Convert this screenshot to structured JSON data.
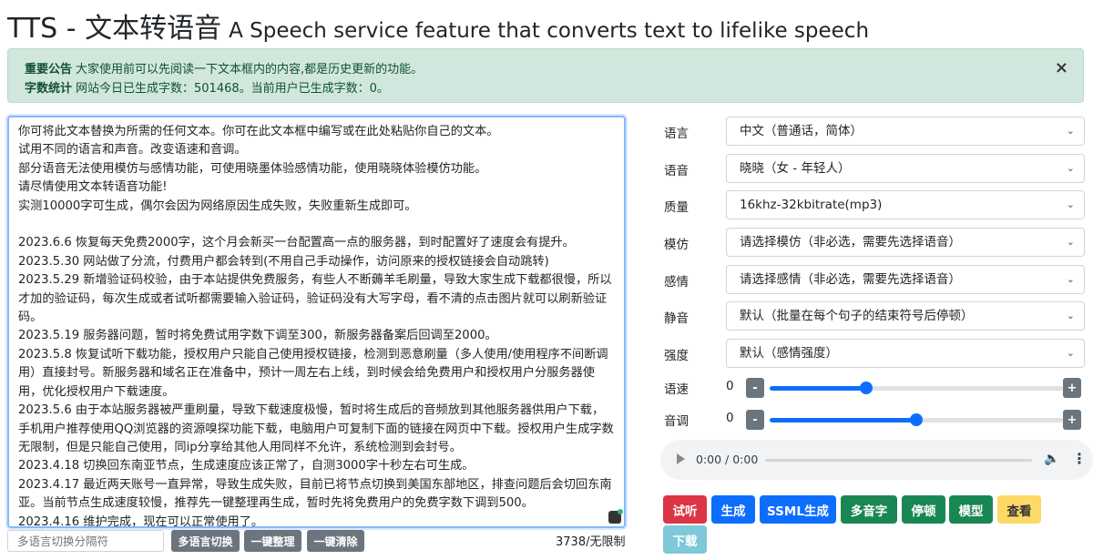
{
  "header": {
    "title_main": "TTS - 文本转语音",
    "title_sub": "A Speech service feature that converts text to lifelike speech"
  },
  "alert": {
    "notice_label": "重要公告",
    "notice_text": "大家使用前可以先阅读一下文本框内的内容,都是历史更新的功能。",
    "stats_label": "字数统计",
    "stats_text": "网站今日已生成字数：501468。当前用户已生成字数：0。",
    "close": "×"
  },
  "editor": {
    "text": "你可将此文本替换为所需的任何文本。你可在此文本框中编写或在此处粘贴你自己的文本。\n试用不同的语言和声音。改变语速和音调。\n部分语音无法使用模仿与感情功能，可使用晓墨体验感情功能，使用晓晓体验模仿功能。\n请尽情使用文本转语音功能!\n实测10000字可生成，偶尔会因为网络原因生成失败，失败重新生成即可。\n\n2023.6.6 恢复每天免费2000字，这个月会新买一台配置高一点的服务器，到时配置好了速度会有提升。\n2023.5.30 网站做了分流，付费用户都会转到(不用自己手动操作，访问原来的授权链接会自动跳转)\n2023.5.29 新增验证码校验，由于本站提供免费服务，有些人不断薅羊毛刷量，导致大家生成下载都很慢，所以才加的验证码，每次生成或者试听都需要输入验证码，验证码没有大写字母，看不清的点击图片就可以刷新验证码。\n2023.5.19 服务器问题，暂时将免费试用字数下调至300，新服务器备案后回调至2000。\n2023.5.8 恢复试听下载功能，授权用户只能自己使用授权链接，检测到恶意刷量（多人使用/使用程序不间断调用）直接封号。新服务器和域名正在准备中，预计一周左右上线，到时候会给免费用户和授权用户分服务器使用，优化授权用户下载速度。\n2023.5.6 由于本站服务器被严重刷量，导致下载速度极慢，暂时将生成后的音频放到其他服务器供用户下载，手机用户推荐使用QQ浏览器的资源嗅探功能下载，电脑用户可复制下面的链接在网页中下载。授权用户生成字数无限制，但是只能自己使用，同ip分享给其他人用同样不允许，系统检测到会封号。\n2023.4.18 切换回东南亚节点，生成速度应该正常了，自测3000字十秒左右可生成。\n2023.4.17 最近两天账号一直异常，导致生成失败，目前已将节点切换到美国东部地区，排查问题后会切回东南亚。当前节点生成速度较慢，推荐先一键整理再生成，暂时先将免费用户的免费字数下调到500。\n2023.4.16 维护完成，现在可以正常使用了。"
  },
  "bottom": {
    "separator_placeholder": "多语言切换分隔符",
    "multi_lang_btn": "多语言切换",
    "tidy_btn": "一键整理",
    "clear_btn": "一键清除",
    "count": "3738/无限制"
  },
  "settings": {
    "language": {
      "label": "语言",
      "value": "中文（普通话，简体）"
    },
    "voice": {
      "label": "语音",
      "value": "晓晓（女 - 年轻人）"
    },
    "quality": {
      "label": "质量",
      "value": "16khz-32kbitrate(mp3)"
    },
    "imitate": {
      "label": "模仿",
      "value": "请选择模仿（非必选，需要先选择语音）"
    },
    "emotion": {
      "label": "感情",
      "value": "请选择感情（非必选，需要先选择语音）"
    },
    "silence": {
      "label": "静音",
      "value": "默认（批量在每个句子的结束符号后停顿）"
    },
    "intensity": {
      "label": "强度",
      "value": "默认（感情强度）"
    },
    "rate": {
      "label": "语速",
      "value": "0",
      "minus": "-",
      "plus": "+",
      "level": 0.33
    },
    "pitch": {
      "label": "音调",
      "value": "0",
      "minus": "-",
      "plus": "+",
      "level": 0.5
    }
  },
  "player": {
    "time": "0:00 / 0:00"
  },
  "actions": {
    "preview": "试听",
    "generate": "生成",
    "ssml": "SSML生成",
    "polyphone": "多音字",
    "pause": "停顿",
    "model": "模型",
    "view": "查看",
    "download": "下载"
  },
  "colors": {
    "danger": "#dc3545",
    "primary": "#0d6efd",
    "success": "#198754",
    "warning": "#ffd966",
    "info": "#7ec8d9",
    "secondary": "#6c757d",
    "alert_bg": "#d1e7dd"
  }
}
